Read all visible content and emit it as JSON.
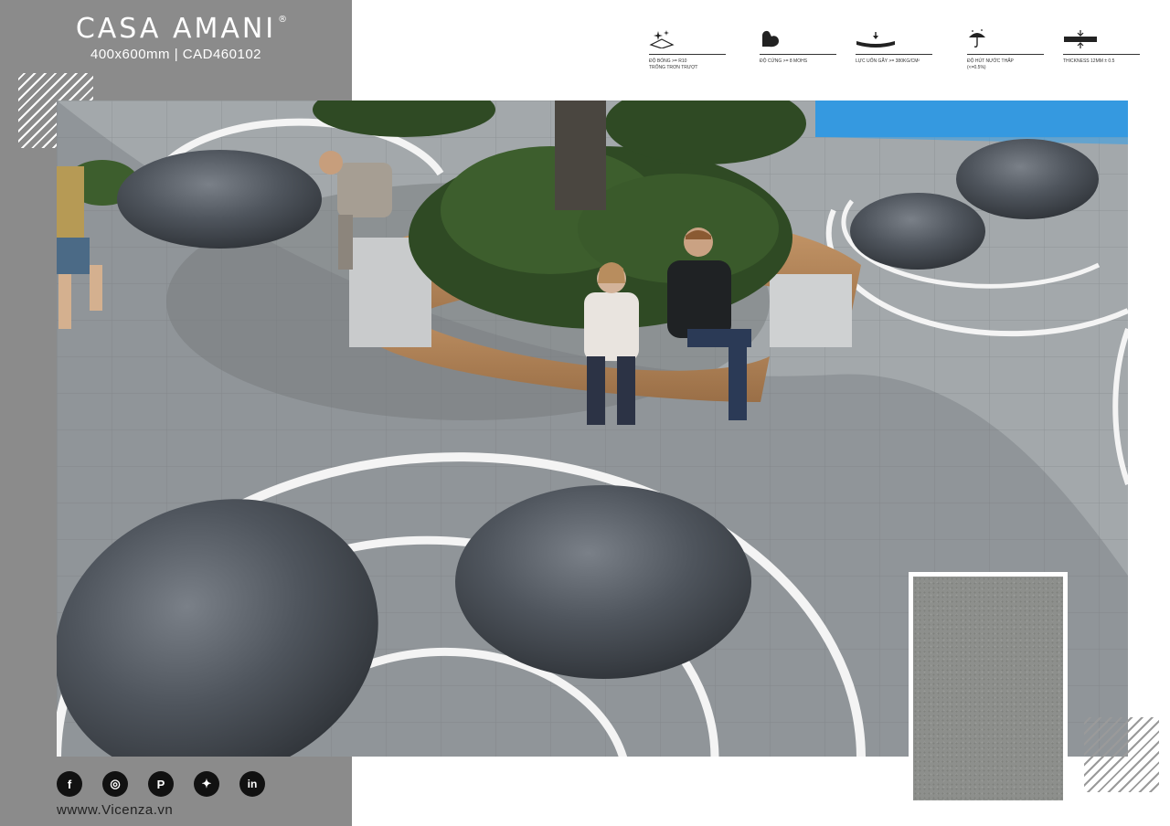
{
  "brand": {
    "title": "CASA AMANI",
    "registered": "®",
    "subtitle": "400x600mm  |  CAD460102"
  },
  "specs": [
    {
      "icon": "gloss-sparkle-icon",
      "label": "ĐỘ BÓNG >= R10\nTRỐNG TRƠN TRƯỢT"
    },
    {
      "icon": "strength-arm-icon",
      "label": "ĐỘ CỨNG >= 8 MOHS"
    },
    {
      "icon": "bending-tile-icon",
      "label": "LỰC UỐN GÃY >= 380KG/CM²"
    },
    {
      "icon": "umbrella-rain-icon",
      "label": "ĐỘ HÚT NƯỚC THẤP\n(<=0.5%)"
    },
    {
      "icon": "thickness-icon",
      "label": "THICKNESS 12MM ± 0.5"
    }
  ],
  "social": [
    {
      "icon": "facebook-icon",
      "glyph": "f"
    },
    {
      "icon": "instagram-icon",
      "glyph": "◎"
    },
    {
      "icon": "pinterest-icon",
      "glyph": "P"
    },
    {
      "icon": "twitter-icon",
      "glyph": "✦"
    },
    {
      "icon": "linkedin-icon",
      "glyph": "in"
    }
  ],
  "website": "wwww.Vicenza.vn",
  "colors": {
    "panel": "#8b8b8b",
    "pavement": "#9ea3a6",
    "stone": "#4c5259",
    "bench_wood": "#b88a5e",
    "tile_sample": "#8d8f8c"
  }
}
